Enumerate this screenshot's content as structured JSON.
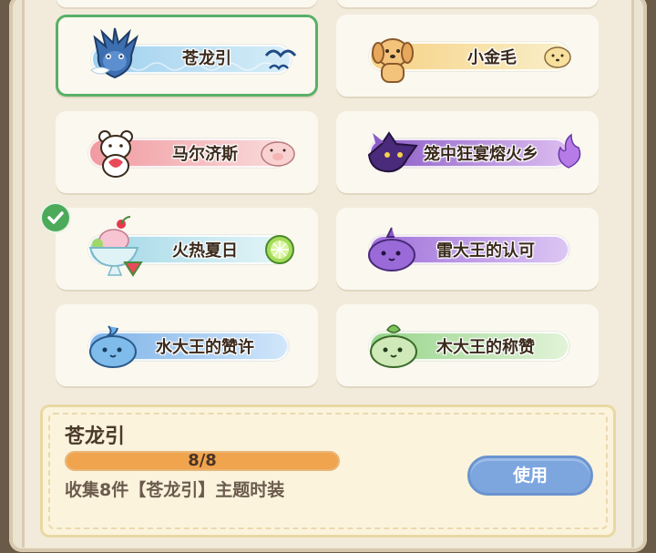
{
  "collections": [
    {
      "id": "canglong",
      "name": "苍龙引",
      "selected": true,
      "banner_from": "#a9d6ef",
      "banner_to": "#cfeaf6",
      "mascot_icon": "blue-dragon-icon",
      "deco_icon": "seagull-icon"
    },
    {
      "id": "xiaojinmao",
      "name": "小金毛",
      "banner_from": "#f7d487",
      "banner_to": "#f8eec8",
      "mascot_icon": "golden-puppy-icon",
      "deco_icon": "puppy-face-icon"
    },
    {
      "id": "maerjisi",
      "name": "马尔济斯",
      "banner_from": "#f1a2a6",
      "banner_to": "#f9d9d9",
      "mascot_icon": "white-bear-icon",
      "deco_icon": "piglet-icon"
    },
    {
      "id": "longzhong",
      "name": "笼中狂宴熔火乡",
      "banner_from": "#8d5fc8",
      "banner_to": "#d9b8ef",
      "mascot_icon": "purple-dragon-icon",
      "deco_icon": "purple-flame-icon"
    },
    {
      "id": "huorexiari",
      "name": "火热夏日",
      "completed": true,
      "banner_from": "#9fd7e6",
      "banner_to": "#e5f5f7",
      "mascot_icon": "ice-dessert-icon",
      "deco_icon": "lime-slice-icon"
    },
    {
      "id": "leidawang",
      "name": "雷大王的认可",
      "banner_from": "#a274da",
      "banner_to": "#dcc4f2",
      "mascot_icon": "thunder-slime-icon",
      "deco_icon": ""
    },
    {
      "id": "shuidawang",
      "name": "水大王的赞许",
      "banner_from": "#7fb4ea",
      "banner_to": "#cfe5f9",
      "mascot_icon": "water-slime-icon",
      "deco_icon": ""
    },
    {
      "id": "mudawang",
      "name": "木大王的称赞",
      "banner_from": "#9ad78b",
      "banner_to": "#e1f3d6",
      "mascot_icon": "wood-slime-icon",
      "deco_icon": ""
    }
  ],
  "detail": {
    "title": "苍龙引",
    "progress_text": "8/8",
    "progress_fraction": 1.0,
    "description": "收集8件【苍龙引】主题时装",
    "action_label": "使用"
  },
  "colors": {
    "accent_green": "#4caa5a",
    "button_blue": "#7da6df",
    "progress_orange": "#f0a44e"
  }
}
